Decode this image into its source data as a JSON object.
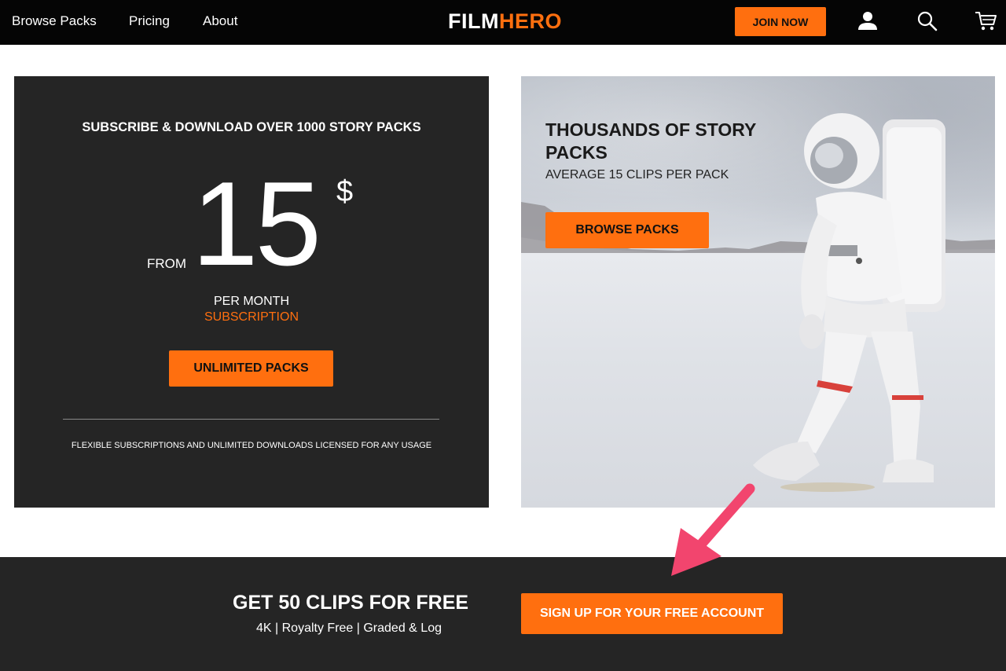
{
  "nav": {
    "links": [
      "Browse Packs",
      "Pricing",
      "About"
    ],
    "logo_part1": "FILM",
    "logo_part2": "HERO",
    "join_label": "JOIN NOW",
    "icons": [
      "user-icon",
      "search-icon",
      "cart-icon"
    ]
  },
  "subscription_card": {
    "heading": "SUBSCRIBE & DOWNLOAD OVER 1000 STORY PACKS",
    "price_prefix": "FROM",
    "price": "15",
    "currency": "$",
    "period": "PER MONTH",
    "period_type": "SUBSCRIPTION",
    "button_label": "UNLIMITED PACKS",
    "footnote": "FLEXIBLE SUBSCRIPTIONS AND UNLIMITED DOWNLOADS LICENSED FOR ANY USAGE"
  },
  "hero_card": {
    "title": "THOUSANDS OF STORY PACKS",
    "subtitle": "AVERAGE 15 CLIPS PER PACK",
    "button_label": "BROWSE PACKS"
  },
  "free_band": {
    "heading": "GET 50 CLIPS FOR FREE",
    "subtext": "4K | Royalty Free | Graded & Log",
    "button_label": "SIGN UP FOR YOUR FREE ACCOUNT"
  },
  "colors": {
    "accent": "#ff6f0f",
    "dark_panel": "#252525",
    "topbar": "#050505",
    "annotation_arrow": "#f2456e"
  }
}
